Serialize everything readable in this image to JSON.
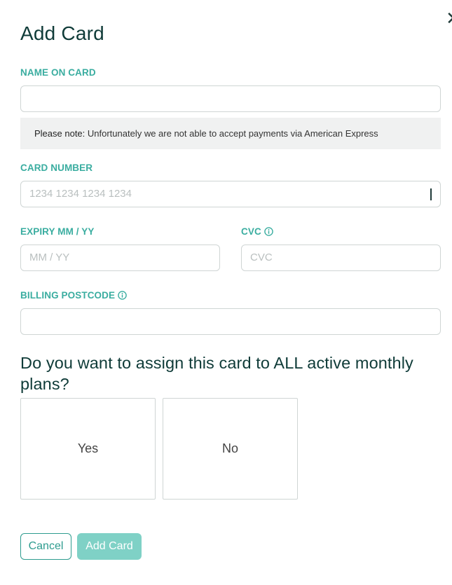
{
  "dialog": {
    "title": "Add Card",
    "close_label": "✕"
  },
  "name_on_card": {
    "label": "NAME ON CARD",
    "value": ""
  },
  "note": {
    "prefix": "Please note:",
    "text": " Unfortunately we are not able to accept payments via American Express"
  },
  "card_number": {
    "label": "CARD NUMBER",
    "placeholder": "1234 1234 1234 1234"
  },
  "expiry": {
    "label": "EXPIRY MM / YY",
    "placeholder": "MM / YY"
  },
  "cvc": {
    "label": "CVC",
    "placeholder": "CVC",
    "icon": "info-icon"
  },
  "postcode": {
    "label": "BILLING POSTCODE",
    "value": "",
    "icon": "info-icon"
  },
  "assign": {
    "question": "Do you want to assign this card to ALL active monthly plans?",
    "options": [
      "Yes",
      "No"
    ]
  },
  "actions": {
    "cancel_label": "Cancel",
    "add_label": "Add Card"
  },
  "colors": {
    "accent": "#3aada0",
    "title": "#0f3b38",
    "primary_disabled": "#7fd1c6"
  }
}
